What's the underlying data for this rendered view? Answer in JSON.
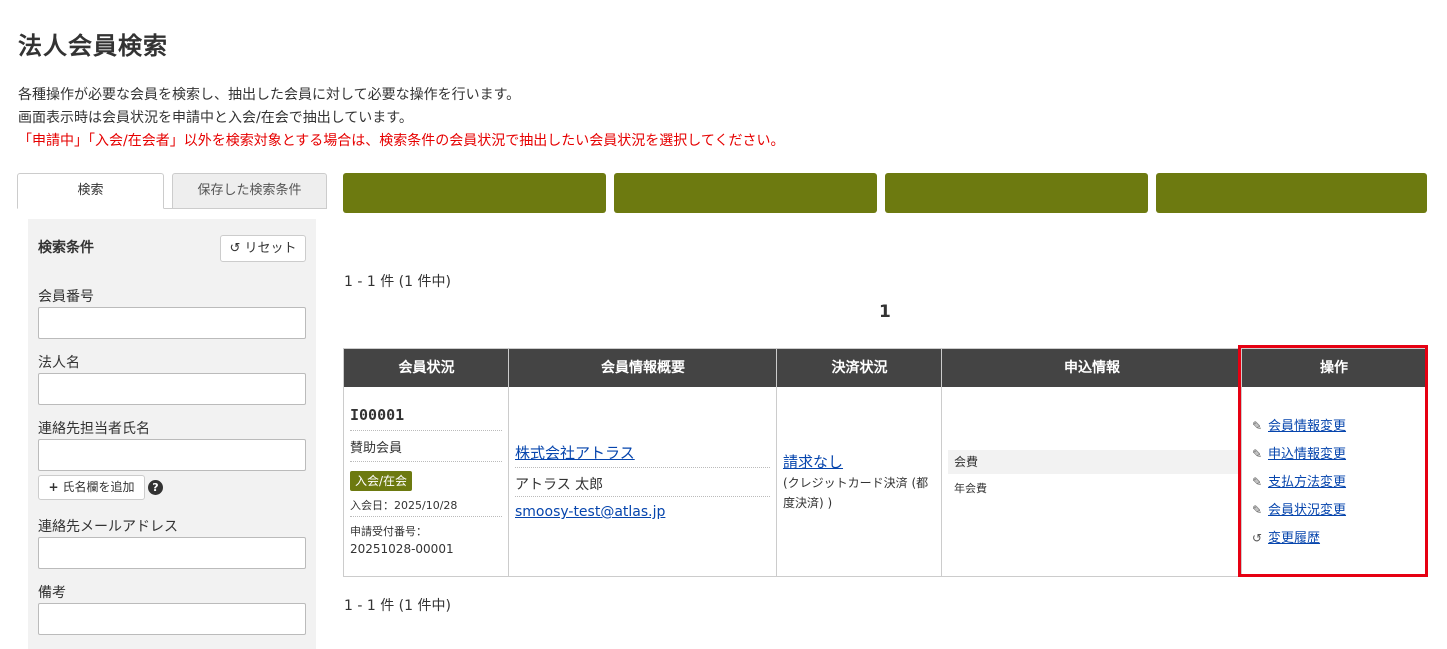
{
  "page": {
    "title": "法人会員検索",
    "description": [
      "各種操作が必要な会員を検索し、抽出した会員に対して必要な操作を行います。",
      "画面表示時は会員状況を申請中と入会/在会で抽出しています。"
    ],
    "warning": "「申請中」「入会/在会者」以外を検索対象とする場合は、検索条件の会員状況で抽出したい会員状況を選択してください。"
  },
  "sidebar": {
    "tabs": [
      "検索",
      "保存した検索条件"
    ],
    "panel_title": "検索条件",
    "reset_label": "リセット",
    "fields": {
      "member_number": "会員番号",
      "corp_name": "法人名",
      "contact_name": "連絡先担当者氏名",
      "contact_email": "連絡先メールアドレス",
      "remarks": "備考"
    },
    "add_name_label": "氏名欄を追加"
  },
  "main": {
    "count_text": "1 - 1 件 (1 件中)",
    "current_page": "1",
    "columns": [
      "会員状況",
      "会員情報概要",
      "決済状況",
      "申込情報",
      "操作"
    ],
    "row": {
      "member_id": "I00001",
      "member_type": "賛助会員",
      "status_badge": "入会/在会",
      "join_date": "入会日：2025/10/28",
      "receipt_label": "申請受付番号：",
      "receipt_number": "20251028-00001",
      "company": "株式会社アトラス",
      "person": "アトラス 太郎",
      "email": "smoosy-test@atlas.jp",
      "payment_status": "請求なし",
      "payment_note": "(クレジットカード決済 (都度決済) )",
      "apply_label": "会費",
      "apply_value": "年会費",
      "operations": [
        "会員情報変更",
        "申込情報変更",
        "支払方法変更",
        "会員状況変更",
        "変更履歴"
      ]
    }
  },
  "colors": {
    "accent_green": "#6d7a10",
    "header_dark": "#444444",
    "warning_red": "#e60000",
    "highlight_red": "#e60012"
  }
}
